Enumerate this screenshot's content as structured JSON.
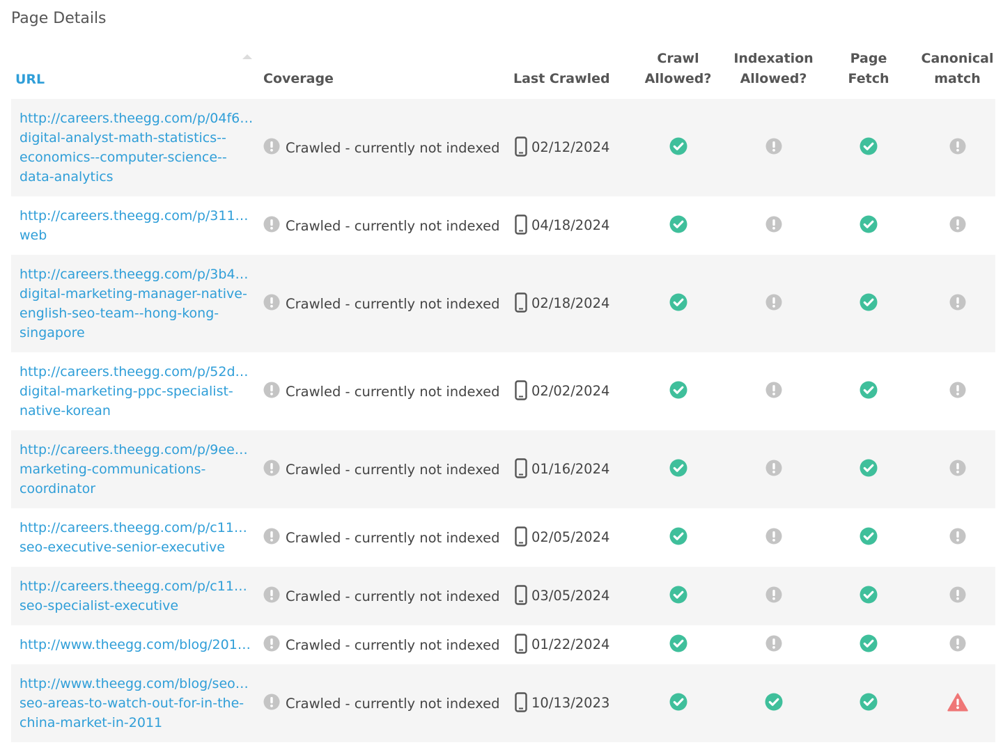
{
  "section_title": "Page Details",
  "columns": {
    "url": "URL",
    "coverage": "Coverage",
    "last_crawled": "Last Crawled",
    "crawl_allowed_1": "Crawl",
    "crawl_allowed_2": "Allowed?",
    "indexation_allowed_1": "Indexation",
    "indexation_allowed_2": "Allowed?",
    "page_fetch_1": "Page",
    "page_fetch_2": "Fetch",
    "canonical_match_1": "Canonical",
    "canonical_match_2": "match"
  },
  "colors": {
    "link": "#2f9ed8",
    "ok": "#3fbf9b",
    "neutral": "#c4c4c4",
    "warn": "#ef7777"
  },
  "rows": [
    {
      "url_first": "http://careers.theegg.com/p/04f6…",
      "url_rest": "digital-analyst-math-statistics--economics--computer-science--data-analytics",
      "coverage": "Crawled - currently not indexed",
      "date": "02/12/2024",
      "crawl": "check-icon",
      "index": "exclamation-icon",
      "fetch": "check-icon",
      "canonical": "exclamation-icon"
    },
    {
      "url_first": "http://careers.theegg.com/p/311…",
      "url_rest": "web",
      "coverage": "Crawled - currently not indexed",
      "date": "04/18/2024",
      "crawl": "check-icon",
      "index": "exclamation-icon",
      "fetch": "check-icon",
      "canonical": "exclamation-icon"
    },
    {
      "url_first": "http://careers.theegg.com/p/3b4…",
      "url_rest": "digital-marketing-manager-native-english-seo-team--hong-kong-singapore",
      "coverage": "Crawled - currently not indexed",
      "date": "02/18/2024",
      "crawl": "check-icon",
      "index": "exclamation-icon",
      "fetch": "check-icon",
      "canonical": "exclamation-icon"
    },
    {
      "url_first": "http://careers.theegg.com/p/52d…",
      "url_rest": "digital-marketing-ppc-specialist-native-korean",
      "coverage": "Crawled - currently not indexed",
      "date": "02/02/2024",
      "crawl": "check-icon",
      "index": "exclamation-icon",
      "fetch": "check-icon",
      "canonical": "exclamation-icon"
    },
    {
      "url_first": "http://careers.theegg.com/p/9ee…",
      "url_rest": "marketing-communications-coordinator",
      "coverage": "Crawled - currently not indexed",
      "date": "01/16/2024",
      "crawl": "check-icon",
      "index": "exclamation-icon",
      "fetch": "check-icon",
      "canonical": "exclamation-icon"
    },
    {
      "url_first": "http://careers.theegg.com/p/c11…",
      "url_rest": "seo-executive-senior-executive",
      "coverage": "Crawled - currently not indexed",
      "date": "02/05/2024",
      "crawl": "check-icon",
      "index": "exclamation-icon",
      "fetch": "check-icon",
      "canonical": "exclamation-icon"
    },
    {
      "url_first": "http://careers.theegg.com/p/c11…",
      "url_rest": "seo-specialist-executive",
      "coverage": "Crawled - currently not indexed",
      "date": "03/05/2024",
      "crawl": "check-icon",
      "index": "exclamation-icon",
      "fetch": "check-icon",
      "canonical": "exclamation-icon"
    },
    {
      "url_first": "http://www.theegg.com/blog/201…",
      "url_rest": "",
      "coverage": "Crawled - currently not indexed",
      "date": "01/22/2024",
      "crawl": "check-icon",
      "index": "exclamation-icon",
      "fetch": "check-icon",
      "canonical": "exclamation-icon"
    },
    {
      "url_first": "http://www.theegg.com/blog/seo…",
      "url_rest": "seo-areas-to-watch-out-for-in-the-china-market-in-2011",
      "coverage": "Crawled - currently not indexed",
      "date": "10/13/2023",
      "crawl": "check-icon",
      "index": "check-icon",
      "fetch": "check-icon",
      "canonical": "warning-triangle-icon"
    }
  ]
}
